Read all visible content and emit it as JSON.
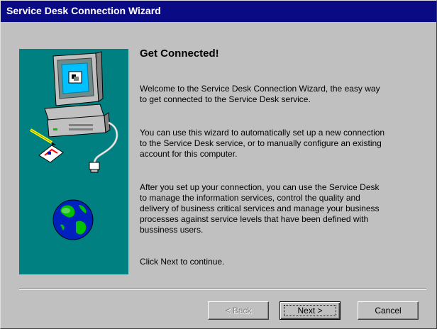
{
  "window": {
    "title": "Service Desk Connection Wizard"
  },
  "content": {
    "heading": "Get Connected!",
    "paragraphs": [
      "Welcome to the Service Desk Connection Wizard, the easy way\nto get connected to the Service Desk service.",
      "You can use this wizard to automatically set up a new connection\nto the Service Desk service, or to manually configure an existing\naccount for this computer.",
      "After you set up your connection, you can use the Service Desk\nto manage the information services, control the quality and\ndelivery of business critical services and manage your business\nprocesses against service levels that have been defined with\nbussiness users.",
      "Click Next to continue."
    ]
  },
  "buttons": {
    "back": "< Back",
    "next": "Next >",
    "cancel": "Cancel"
  },
  "graphic": {
    "icons": [
      "computer-icon",
      "pencil-icon",
      "envelope-icon",
      "cable-plug-icon",
      "globe-icon"
    ]
  }
}
